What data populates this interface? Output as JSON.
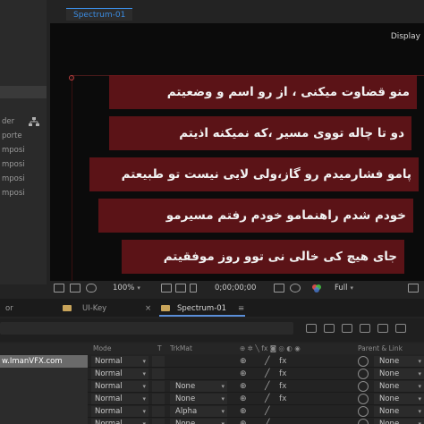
{
  "viewer": {
    "comp_tab": "Spectrum-01",
    "display_label": "Display",
    "subtitles": [
      "منو قضاوت میکنی ، از رو اسم و وضعیتم",
      "دو تا چاله تووی مسیر ،که نمیکنه اذیتم",
      "پامو فشارمیدم رو گاز،ولی لایی نیست تو طبیعتم",
      "خودم شدم راهنمامو خودم رفتم مسیرمو",
      "جای هیچ کی خالی نی توو روز موفقیتم"
    ]
  },
  "project": {
    "items": [
      "der",
      "porte",
      "mposi",
      "mposi",
      "mposi",
      "mposi"
    ]
  },
  "viewer_toolbar": {
    "zoom": "100%",
    "timecode": "0;00;00;00",
    "resolution": "Full"
  },
  "timeline": {
    "tabs": [
      {
        "label": "or"
      },
      {
        "label": "UI-Key"
      },
      {
        "label": "Spectrum-01"
      }
    ],
    "close_glyph": "×",
    "menu_glyph": "≡",
    "columns": {
      "mode": "Mode",
      "t": "T",
      "trkmat": "TrkMat",
      "parent": "Parent & Link"
    },
    "layers": [
      {
        "name": "w.ImanVFX.com",
        "mode": "Normal",
        "trkmat": "",
        "parent": "None",
        "selected": true
      },
      {
        "name": "",
        "mode": "Normal",
        "trkmat": "",
        "parent": "None",
        "selected": false
      },
      {
        "name": "",
        "mode": "Normal",
        "trkmat": "None",
        "parent": "None",
        "selected": false
      },
      {
        "name": "",
        "mode": "Normal",
        "trkmat": "None",
        "parent": "None",
        "selected": false
      },
      {
        "name": "",
        "mode": "Normal",
        "trkmat": "Alpha",
        "parent": "None",
        "selected": false
      },
      {
        "name": "",
        "mode": "Normal",
        "trkmat": "None",
        "parent": "None",
        "selected": false
      }
    ]
  },
  "colors": {
    "subtitle_bg": "#7a161c",
    "tab_accent": "#3b8be0",
    "viewer_bg": "#0b0b0b"
  },
  "icons": {
    "flowchart": "flowchart-icon",
    "snapshot": "camera-icon",
    "channels": "rgb-channels-icon",
    "parent_link": "pick-whip-icon"
  }
}
